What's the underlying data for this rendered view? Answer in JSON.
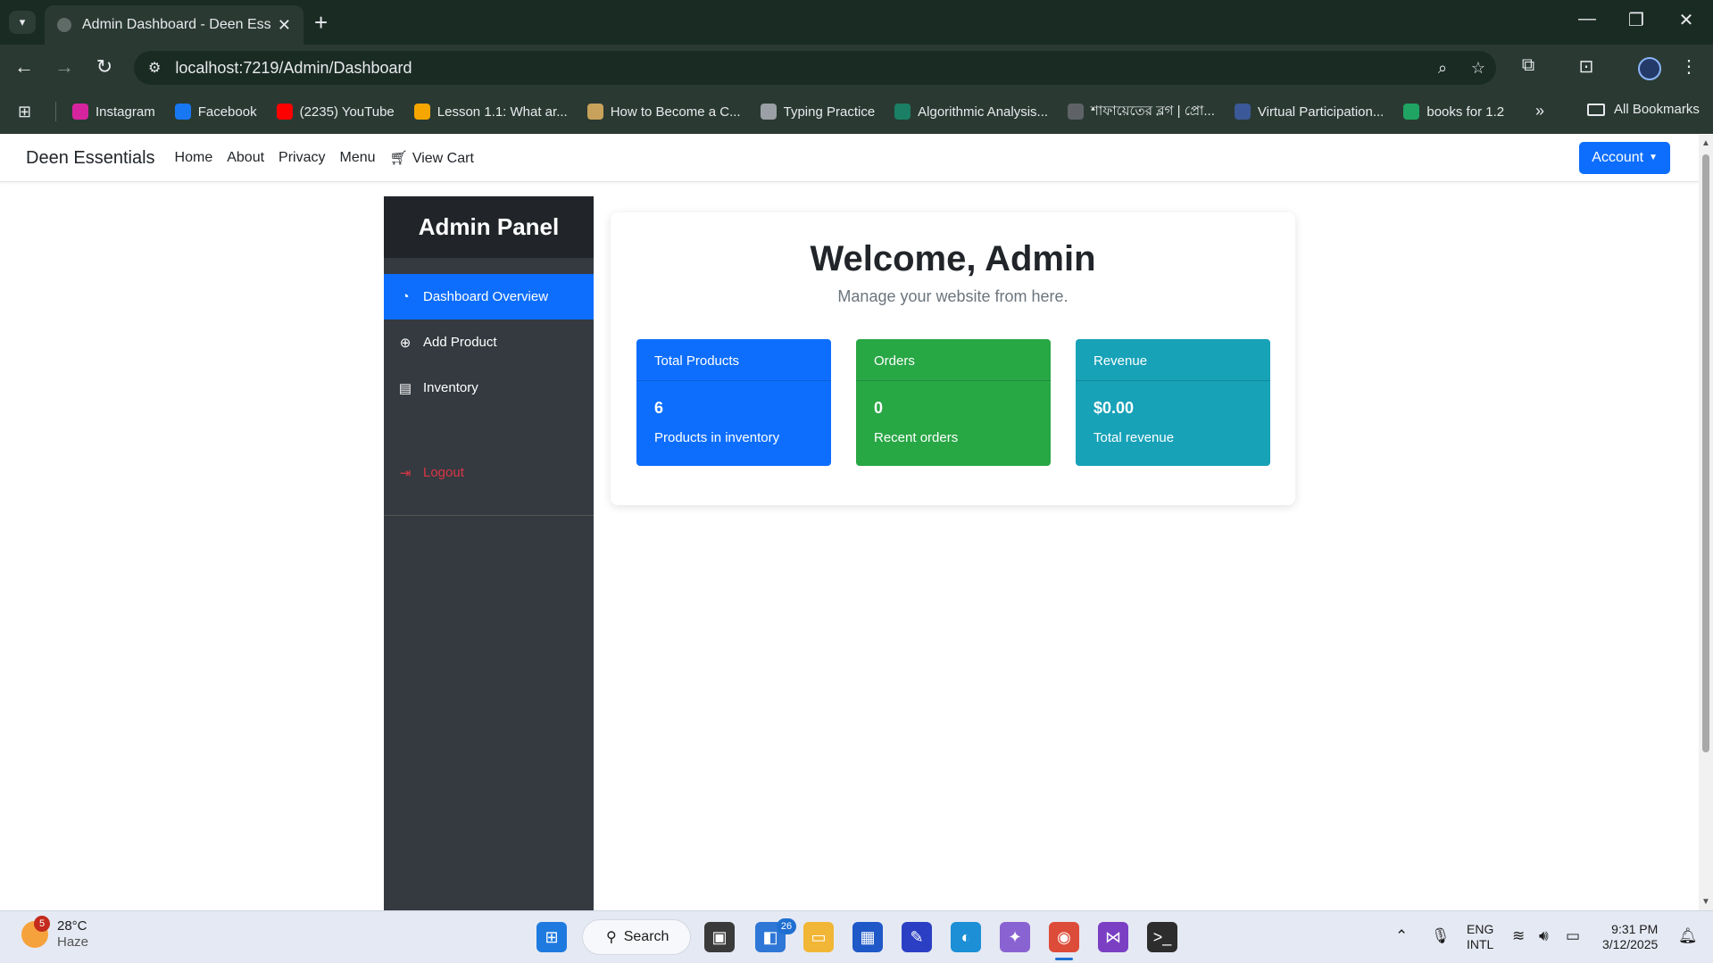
{
  "browser": {
    "tab_title": "Admin Dashboard - Deen Essentials",
    "url": "localhost:7219/Admin/Dashboard",
    "bookmarks": [
      {
        "label": "Instagram",
        "icon": "instagram-icon",
        "color": "#d6249f"
      },
      {
        "label": "Facebook",
        "icon": "facebook-icon",
        "color": "#1877f2"
      },
      {
        "label": "(2235) YouTube",
        "icon": "youtube-icon",
        "color": "#ff0000"
      },
      {
        "label": "Lesson 1.1: What ar...",
        "icon": "lesson-icon",
        "color": "#f7a600"
      },
      {
        "label": "How to Become a C...",
        "icon": "bookmark-page-icon",
        "color": "#c8a25a"
      },
      {
        "label": "Typing Practice",
        "icon": "typing-icon",
        "color": "#9aa0a6"
      },
      {
        "label": "Algorithmic Analysis...",
        "icon": "algorithmic-icon",
        "color": "#1a7f64"
      },
      {
        "label": "শাফায়েতের ব্লগ | প্রো...",
        "icon": "globe-icon",
        "color": "#5f6368"
      },
      {
        "label": "Virtual Participation...",
        "icon": "codeforces-icon",
        "color": "#3b5998"
      },
      {
        "label": "books for 1.2",
        "icon": "google-drive-icon",
        "color": "#1fa463"
      }
    ],
    "all_bookmarks": "All Bookmarks"
  },
  "site": {
    "brand": "Deen Essentials",
    "nav": [
      "Home",
      "About",
      "Privacy",
      "Menu"
    ],
    "cart_label": "View Cart",
    "account_label": "Account"
  },
  "sidebar": {
    "title": "Admin Panel",
    "items": [
      {
        "label": "Dashboard Overview",
        "icon": "tachometer-icon"
      },
      {
        "label": "Add Product",
        "icon": "plus-circle-icon"
      },
      {
        "label": "Inventory",
        "icon": "boxes-icon"
      }
    ],
    "logout": "Logout"
  },
  "main": {
    "welcome": "Welcome, Admin",
    "subtitle": "Manage your website from here.",
    "cards": [
      {
        "header": "Total Products",
        "value": "6",
        "desc": "Products in inventory",
        "color": "#0d6efd"
      },
      {
        "header": "Orders",
        "value": "0",
        "desc": "Recent orders",
        "color": "#28a745"
      },
      {
        "header": "Revenue",
        "value": "$0.00",
        "desc": "Total revenue",
        "color": "#17a2b8"
      }
    ]
  },
  "taskbar": {
    "weather_temp": "28°C",
    "weather_cond": "Haze",
    "weather_badge": "5",
    "search_label": "Search",
    "badge_count": "26",
    "lang_top": "ENG",
    "lang_bottom": "INTL",
    "time": "9:31 PM",
    "date": "3/12/2025"
  }
}
